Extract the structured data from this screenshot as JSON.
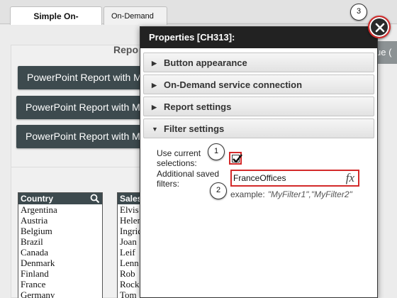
{
  "tabs": [
    {
      "label": "Simple On-Demand",
      "active": true
    },
    {
      "label": "On-Demand",
      "active": false,
      "status_color": "#6dbf3f"
    }
  ],
  "background": {
    "panel_title": "Repo",
    "buttons": [
      "PowerPoint Report with My Selections",
      "PowerPoint Report with My Selections",
      "PowerPoint Report with My Selections"
    ],
    "value_chip": "ue (",
    "country_list": {
      "header": "Country",
      "items": [
        "Argentina",
        "Austria",
        "Belgium",
        "Brazil",
        "Canada",
        "Denmark",
        "Finland",
        "France",
        "Germany"
      ]
    },
    "sales_list": {
      "header": "Sales",
      "items": [
        "Elvis",
        "Helen",
        "Ingrid",
        "Joan",
        "Leif",
        "Lenn",
        "Rob",
        "Rock",
        "Tom"
      ]
    }
  },
  "dialog": {
    "title": "Properties [CH313]:",
    "sections": [
      {
        "label": "Button appearance",
        "expanded": false
      },
      {
        "label": "On-Demand service connection",
        "expanded": false
      },
      {
        "label": "Report settings",
        "expanded": false
      },
      {
        "label": "Filter settings",
        "expanded": true
      }
    ],
    "filter_settings": {
      "use_current_label": "Use current selections:",
      "use_current_checked": true,
      "additional_label": "Additional saved filters:",
      "additional_value": "FranceOffices",
      "fx_label": "fx",
      "example_label": "example:",
      "example_value": "\"MyFilter1\",\"MyFilter2\""
    }
  },
  "callouts": [
    "1",
    "2",
    "3"
  ],
  "colors": {
    "accent_red": "#d32a2a",
    "dark_header": "#222222",
    "button_bg": "#3d4a4e"
  }
}
